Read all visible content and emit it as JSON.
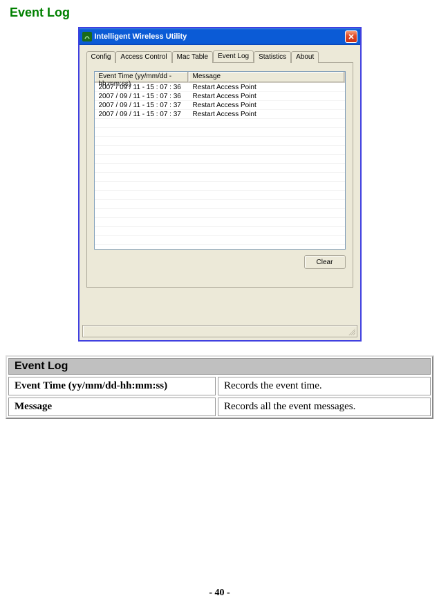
{
  "page": {
    "title": "Event Log",
    "number": "- 40 -"
  },
  "window": {
    "title": "Intelligent Wireless Utility",
    "tabs": [
      "Config",
      "Access Control",
      "Mac Table",
      "Event Log",
      "Statistics",
      "About"
    ],
    "active_tab": 3,
    "columns": [
      "Event Time (yy/mm/dd - hh:mm:ss)",
      "Message"
    ],
    "rows": [
      {
        "time": "2007 / 09 / 11 - 15 : 07 : 36",
        "msg": "Restart Access Point"
      },
      {
        "time": "2007 / 09 / 11 - 15 : 07 : 36",
        "msg": "Restart Access Point"
      },
      {
        "time": "2007 / 09 / 11 - 15 : 07 : 37",
        "msg": "Restart Access Point"
      },
      {
        "time": "2007 / 09 / 11 - 15 : 07 : 37",
        "msg": "Restart Access Point"
      }
    ],
    "clear_label": "Clear"
  },
  "info_table": {
    "header": "Event Log",
    "rows": [
      {
        "label": "Event Time (yy/mm/dd-hh:mm:ss)",
        "desc": "Records the event time."
      },
      {
        "label": "Message",
        "desc": "Records all the event messages."
      }
    ]
  }
}
